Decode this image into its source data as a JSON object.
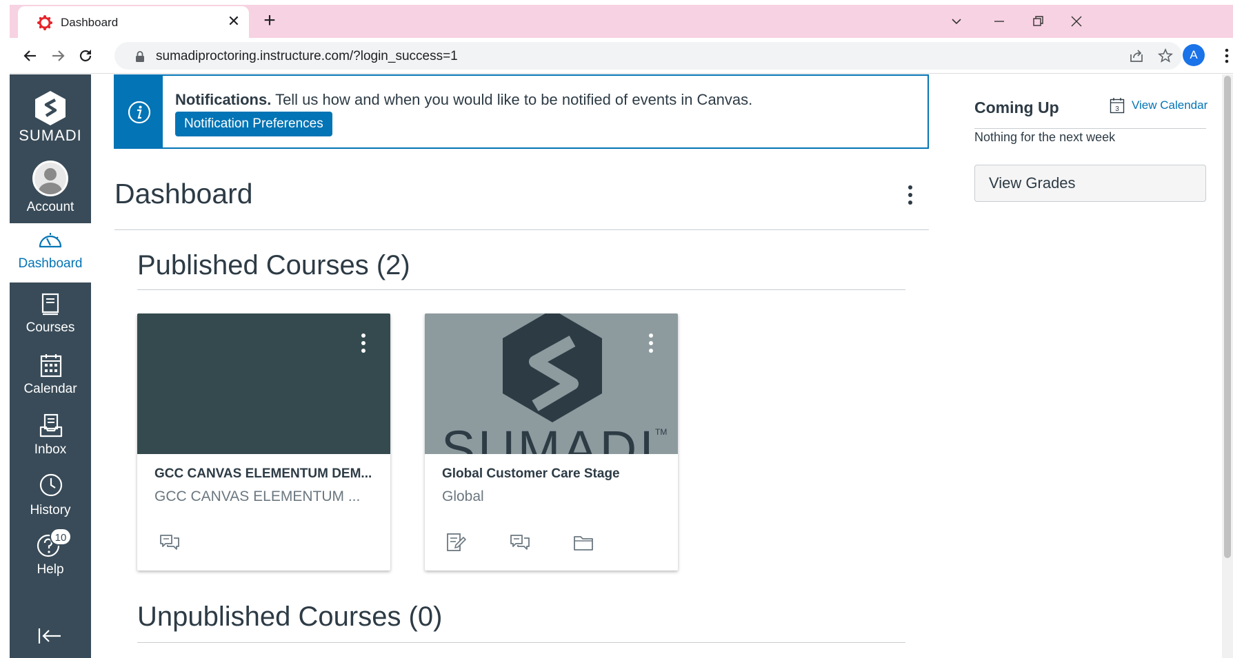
{
  "browser": {
    "tab_title": "Dashboard",
    "tab_close": "✕",
    "new_tab": "+",
    "url": "sumadiproctoring.instructure.com/?login_success=1",
    "profile_initial": "A"
  },
  "global_nav": {
    "brand": "SUMADI",
    "items": [
      {
        "label": "Account",
        "icon": "user-avatar-icon",
        "active": false
      },
      {
        "label": "Dashboard",
        "icon": "dashboard-gauge-icon",
        "active": true
      },
      {
        "label": "Courses",
        "icon": "book-icon",
        "active": false
      },
      {
        "label": "Calendar",
        "icon": "calendar-icon",
        "active": false
      },
      {
        "label": "Inbox",
        "icon": "inbox-icon",
        "active": false
      },
      {
        "label": "History",
        "icon": "clock-icon",
        "active": false
      },
      {
        "label": "Help",
        "icon": "help-icon",
        "active": false,
        "badge": "10"
      }
    ],
    "collapse_icon": "collapse-nav-icon"
  },
  "notification": {
    "title": "Notifications.",
    "message": "Tell us how and when you would like to be notified of events in Canvas.",
    "button_label": "Notification Preferences"
  },
  "dashboard": {
    "title": "Dashboard",
    "published_heading": "Published Courses (2)",
    "unpublished_heading": "Unpublished Courses (0)",
    "courses": [
      {
        "title": "GCC CANVAS ELEMENTUM DEM...",
        "subtitle": "GCC CANVAS ELEMENTUM ...",
        "hero_color": "#344a4f",
        "actions": [
          "discussions-icon"
        ]
      },
      {
        "title": "Global Customer Care Stage",
        "subtitle": "Global",
        "hero_color": "#8d9b9f",
        "hero_logo_text": "SUMADI",
        "actions": [
          "assignments-icon",
          "discussions-icon",
          "files-folder-icon"
        ]
      }
    ]
  },
  "sidebar": {
    "coming_up_title": "Coming Up",
    "view_calendar": "View Calendar",
    "calendar_day": "3",
    "empty_text": "Nothing for the next week",
    "view_grades": "View Grades"
  },
  "colors": {
    "nav_bg": "#394b58",
    "link_blue": "#0374b5",
    "tabbar_pink": "#f7d2e2",
    "text": "#2d3b45"
  }
}
